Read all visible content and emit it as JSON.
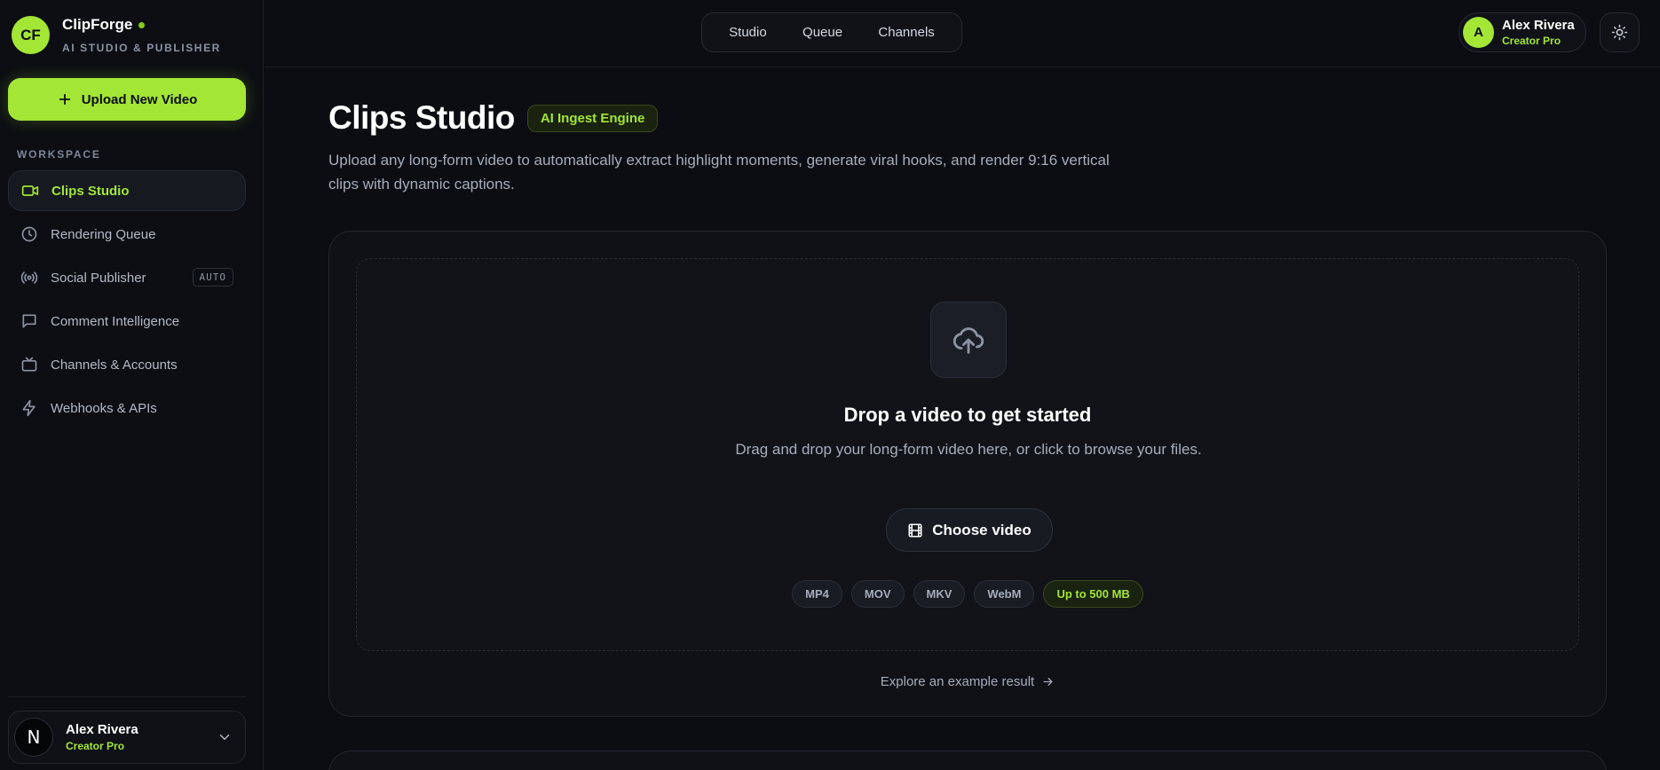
{
  "brand": {
    "logo_initials": "CF",
    "name": "ClipForge",
    "subtitle": "AI STUDIO & PUBLISHER"
  },
  "sidebar": {
    "upload_button_label": "Upload New Video",
    "section_label": "WORKSPACE",
    "items": [
      {
        "label": "Clips Studio",
        "icon": "video-camera-icon",
        "active": true
      },
      {
        "label": "Rendering Queue",
        "icon": "clock-icon"
      },
      {
        "label": "Social Publisher",
        "icon": "broadcast-icon",
        "badge": "AUTO"
      },
      {
        "label": "Comment Intelligence",
        "icon": "message-square-icon"
      },
      {
        "label": "Channels & Accounts",
        "icon": "tv-icon"
      },
      {
        "label": "Webhooks & APIs",
        "icon": "zap-icon"
      }
    ],
    "user": {
      "avatar_glyph": "N",
      "name": "Alex Rivera",
      "plan": "Creator Pro"
    }
  },
  "topbar": {
    "nav": [
      "Studio",
      "Queue",
      "Channels"
    ],
    "user": {
      "initial": "A",
      "name": "Alex Rivera",
      "plan": "Creator Pro"
    }
  },
  "main": {
    "title": "Clips Studio",
    "badge": "AI Ingest Engine",
    "description": "Upload any long-form video to automatically extract highlight moments, generate viral hooks, and render 9:16 vertical clips with dynamic captions.",
    "dropzone": {
      "title": "Drop a video to get started",
      "text": "Drag and drop your long-form video here, or click to browse your files.",
      "button_label": "Choose video",
      "formats": [
        "MP4",
        "MOV",
        "MKV",
        "WebM"
      ],
      "size_limit": "Up to 500 MB"
    },
    "explore_link": "Explore an example result"
  },
  "colors": {
    "accent": "#a3e635",
    "background": "#0b0d12",
    "surface": "#0f1116"
  }
}
